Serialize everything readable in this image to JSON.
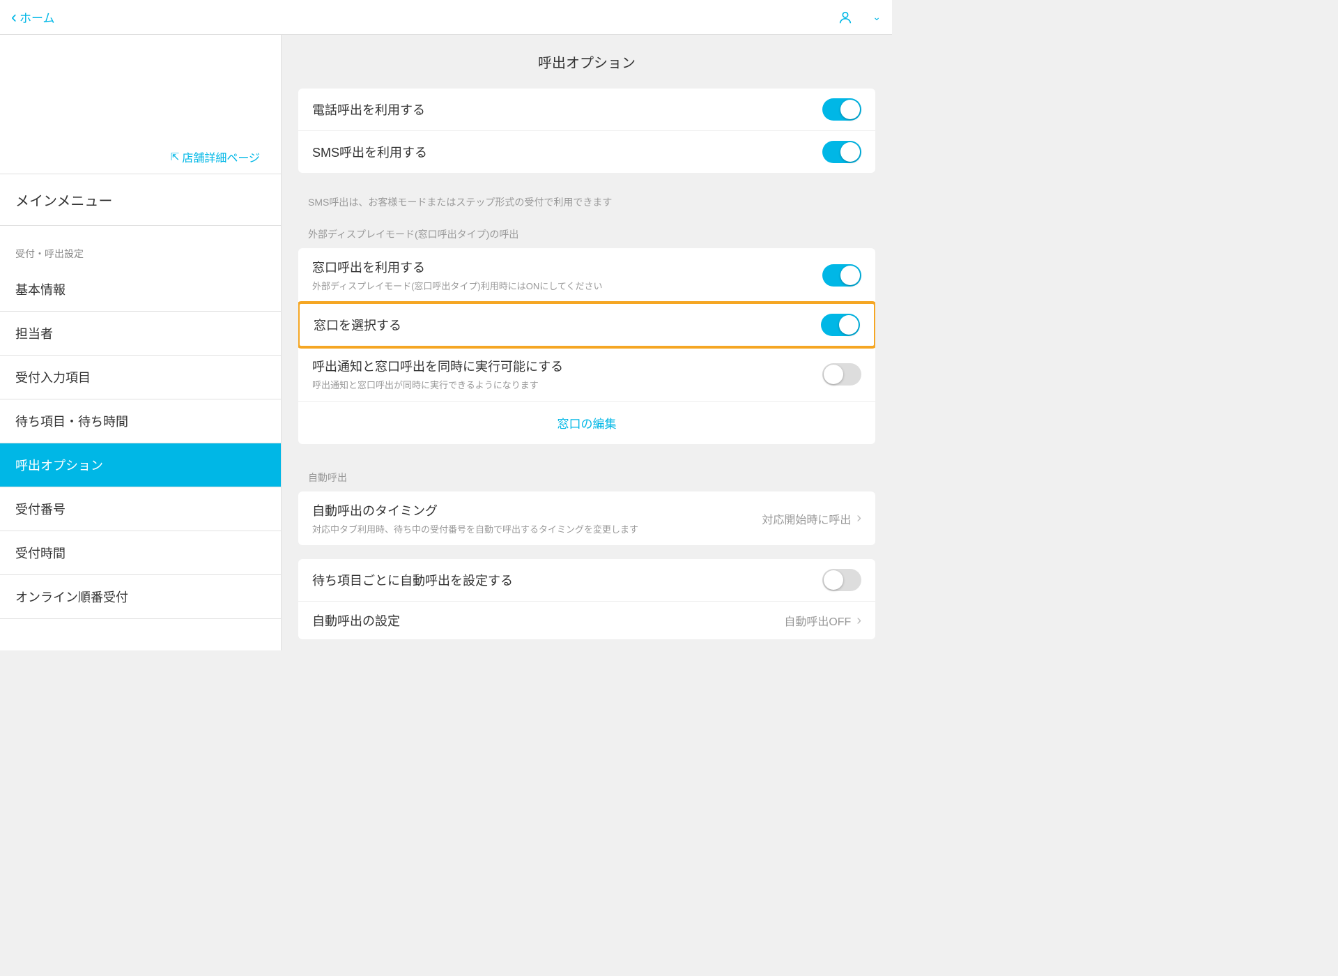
{
  "topbar": {
    "back_label": "ホーム"
  },
  "sidebar": {
    "store_link": "店舗詳細ページ",
    "main_menu": "メインメニュー",
    "section_label": "受付・呼出設定",
    "items": [
      {
        "label": "基本情報"
      },
      {
        "label": "担当者"
      },
      {
        "label": "受付入力項目"
      },
      {
        "label": "待ち項目・待ち時間"
      },
      {
        "label": "呼出オプション",
        "active": true
      },
      {
        "label": "受付番号"
      },
      {
        "label": "受付時間"
      },
      {
        "label": "オンライン順番受付"
      }
    ]
  },
  "main": {
    "title": "呼出オプション",
    "group1": {
      "row1": {
        "label": "電話呼出を利用する",
        "on": true
      },
      "row2": {
        "label": "SMS呼出を利用する",
        "on": true
      },
      "caption": "SMS呼出は、お客様モードまたはステップ形式の受付で利用できます"
    },
    "group2_header": "外部ディスプレイモード(窓口呼出タイプ)の呼出",
    "group2": {
      "row1": {
        "label": "窓口呼出を利用する",
        "desc": "外部ディスプレイモード(窓口呼出タイプ)利用時にはONにしてください",
        "on": true
      },
      "row2": {
        "label": "窓口を選択する",
        "on": true
      },
      "row3": {
        "label": "呼出通知と窓口呼出を同時に実行可能にする",
        "desc": "呼出通知と窓口呼出が同時に実行できるようになります",
        "on": false
      },
      "link": "窓口の編集"
    },
    "group3_header": "自動呼出",
    "group3": {
      "row1": {
        "label": "自動呼出のタイミング",
        "desc": "対応中タブ利用時、待ち中の受付番号を自動で呼出するタイミングを変更します",
        "value": "対応開始時に呼出"
      }
    },
    "group4": {
      "row1": {
        "label": "待ち項目ごとに自動呼出を設定する",
        "on": false
      },
      "row2": {
        "label": "自動呼出の設定",
        "value": "自動呼出OFF"
      }
    }
  }
}
